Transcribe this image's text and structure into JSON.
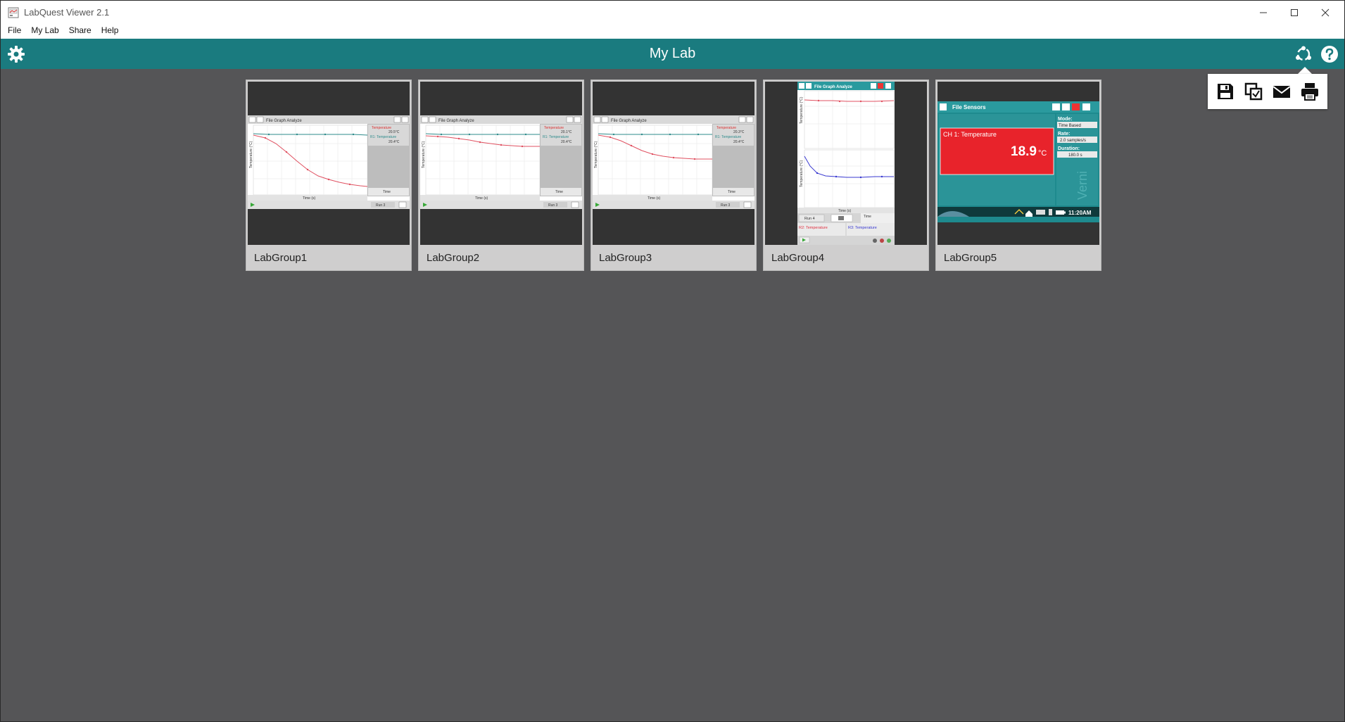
{
  "window": {
    "title": "LabQuest Viewer 2.1",
    "minimize_icon": "minimize-icon",
    "maximize_icon": "maximize-icon",
    "close_icon": "close-icon"
  },
  "menu": {
    "items": [
      {
        "label": "File"
      },
      {
        "label": "My Lab"
      },
      {
        "label": "Share"
      },
      {
        "label": "Help"
      }
    ]
  },
  "header": {
    "title": "My Lab",
    "accent_color": "#1a7b7f",
    "settings_icon": "gear-icon",
    "share_icon": "share-icon",
    "help_icon": "help-icon"
  },
  "share_menu": {
    "items": [
      {
        "icon": "save-icon"
      },
      {
        "icon": "copy-icon"
      },
      {
        "icon": "email-icon"
      },
      {
        "icon": "print-icon"
      }
    ]
  },
  "cards": [
    {
      "label": "LabGroup1",
      "run": "Run 3",
      "menus": "File  Graph  Analyze",
      "legend1": "Temperature",
      "legend2": "R1: Temperature",
      "val1": "20.5°C",
      "val2": "20.4°C"
    },
    {
      "label": "LabGroup2",
      "run": "Run 3",
      "menus": "File  Graph  Analyze",
      "legend1": "Temperature",
      "legend2": "R1: Temperature",
      "val1": "20.1°C",
      "val2": "20.4°C"
    },
    {
      "label": "LabGroup3",
      "run": "Run 3",
      "menus": "File  Graph  Analyze",
      "legend1": "Temperature",
      "legend2": "R1: Temperature",
      "val1": "20.3°C",
      "val2": "20.4°C"
    },
    {
      "label": "LabGroup4",
      "run": "Run 4",
      "menus": "File  Graph  Analyze",
      "legend1": "R2: Temperature",
      "legend2": "R3: Temperature",
      "time_label": "Time (s)"
    },
    {
      "label": "LabGroup5",
      "menus": "File  Sensors",
      "sensor_label": "CH 1: Temperature",
      "sensor_value": "18.9",
      "sensor_unit": "°C",
      "mode_label": "Mode:",
      "mode_value": "Time Based",
      "rate_label": "Rate:",
      "rate_value": "2.0 samples/s",
      "duration_label": "Duration:",
      "duration_value": "180.0 s",
      "clock": "11:20AM",
      "accent_color": "#e8232b"
    }
  ],
  "colors": {
    "background": "#555557",
    "card": "#cfcece",
    "thumb": "#333333",
    "teal": "#1a7b7f"
  }
}
